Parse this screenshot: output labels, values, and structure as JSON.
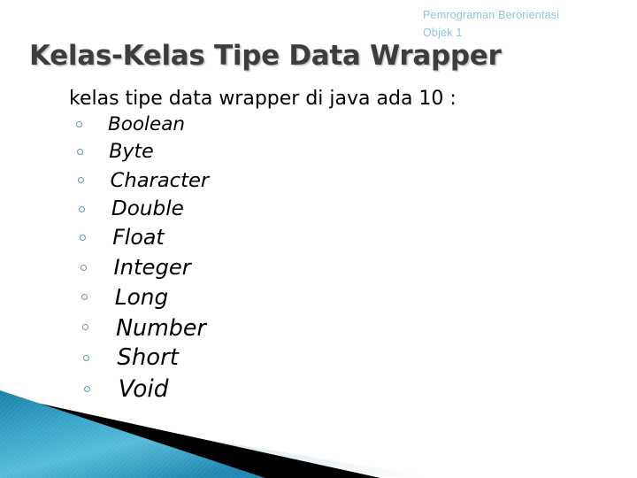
{
  "slide": {
    "header": {
      "line1": "Pemrograman Berorientasi",
      "line2": "Objek 1"
    },
    "title": "Kelas-Kelas Tipe Data Wrapper",
    "intro": "kelas tipe data wrapper di java ada 10 :",
    "items": [
      {
        "label": "Boolean"
      },
      {
        "label": "Byte"
      },
      {
        "label": "Character"
      },
      {
        "label": "Double"
      },
      {
        "label": "Float"
      },
      {
        "label": "Integer"
      },
      {
        "label": "Long"
      },
      {
        "label": "Number"
      },
      {
        "label": "Short"
      },
      {
        "label": "Void"
      }
    ],
    "colors": {
      "header_text": "#8ec5de",
      "title_text": "#3d3d3d",
      "body_text": "#000000",
      "bullet_outline": "#5e9aa8",
      "teal_dark": "#1b7fa8",
      "teal_mid": "#3aa8cc",
      "teal_light": "#63c0dc",
      "band_black": "#000000",
      "wedge_light": "#dde8ee",
      "background": "#ffffff"
    },
    "bullet_glyph": "hollow-circle"
  }
}
